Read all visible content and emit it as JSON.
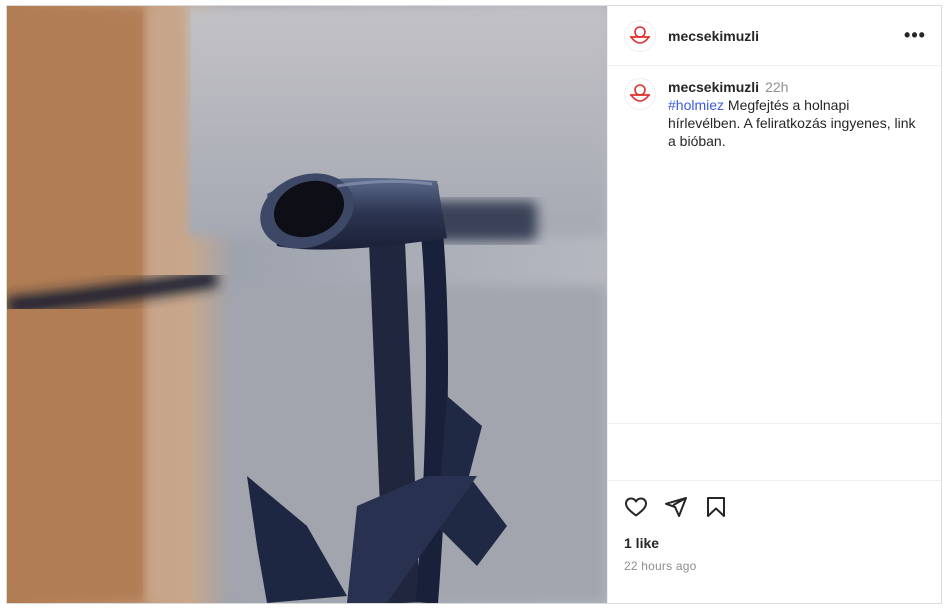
{
  "post": {
    "username": "mecsekimuzli",
    "more_label": "•••",
    "caption": {
      "username": "mecsekimuzli",
      "time": "22h",
      "hashtag": "#holmiez",
      "text": " Megfejtés a holnapi hírlevélben. A feliratkozás ingyenes, link a bióban."
    },
    "likes": "1 like",
    "time_ago": "22 hours ago",
    "icons": {
      "avatar": "bowl-avatar-icon",
      "like": "heart-icon",
      "share": "paper-plane-icon",
      "save": "bookmark-icon"
    },
    "colors": {
      "hashtag": "#3b5bdb",
      "avatar_accent": "#e0302f"
    }
  }
}
